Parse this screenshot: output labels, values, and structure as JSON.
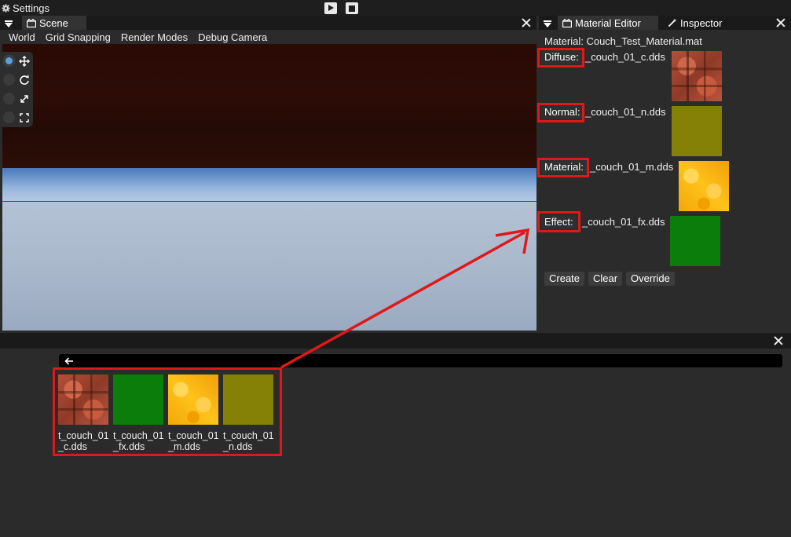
{
  "topbar": {
    "settings_label": "Settings"
  },
  "scene": {
    "tab_label": "Scene",
    "menu": [
      "World",
      "Grid Snapping",
      "Render Modes",
      "Debug Camera"
    ]
  },
  "right_panel": {
    "tabs": [
      "Material Editor",
      "Inspector"
    ],
    "material_title": "Material: Couch_Test_Material.mat",
    "slots": [
      {
        "label": "Diffuse:",
        "file": "_couch_01_c.dds"
      },
      {
        "label": "Normal:",
        "file": "_couch_01_n.dds"
      },
      {
        "label": "Material:",
        "file": "_couch_01_m.dds"
      },
      {
        "label": "Effect:",
        "file": "_couch_01_fx.dds"
      }
    ],
    "buttons": {
      "create": "Create",
      "clear": "Clear",
      "override": "Override"
    }
  },
  "assets": [
    {
      "name": "t_couch_01_c.dds",
      "texture": "couch-diffuse"
    },
    {
      "name": "t_couch_01_fx.dds",
      "texture": "green"
    },
    {
      "name": "t_couch_01_m.dds",
      "texture": "yellow"
    },
    {
      "name": "t_couch_01_n.dds",
      "texture": "olive"
    }
  ],
  "colors": {
    "annotation": "#e01818",
    "panel": "#2b2b2b",
    "tabbar": "#1a1a1a"
  }
}
